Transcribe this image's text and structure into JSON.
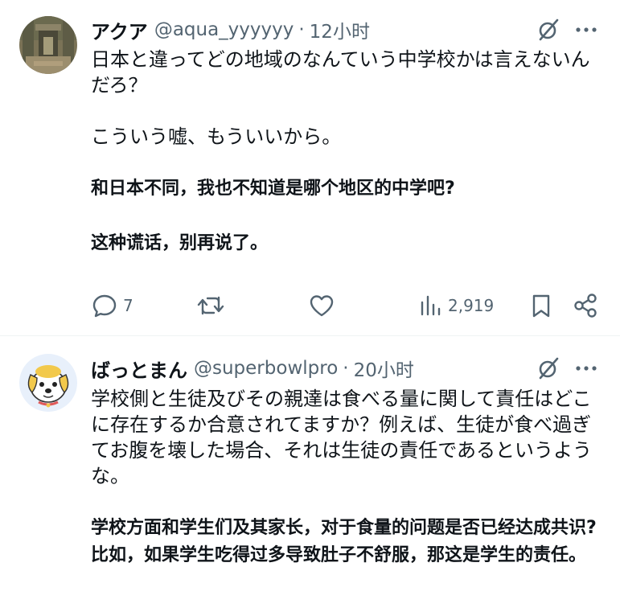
{
  "tweets": [
    {
      "name": "アクア",
      "handle": "@aqua_yyyyyy",
      "separator": "·",
      "time": "12小时",
      "text": "日本と違ってどの地域のなんていう中学校かは言えないんだろ？\n\nこういう嘘、もういいから。",
      "translation": "和日本不同，我也不知道是哪个地区的中学吧?\n\n这种谎话，别再说了。",
      "replies": "7",
      "views": "2,919",
      "icons": [
        "reply-icon",
        "retweet-icon",
        "like-icon",
        "views-icon",
        "bookmark-icon",
        "share-icon",
        "grok-icon",
        "more-icon"
      ]
    },
    {
      "name": "ばっとまん",
      "handle": "@superbowlpro",
      "separator": "·",
      "time": "20小时",
      "text": "学校側と生徒及びその親達は食べる量に関して責任はどこに存在するか合意されてますか？例えば、生徒が食べ過ぎてお腹を壊した場合、それは生徒の責任であるというような。",
      "translation": "学校方面和学生们及其家长，对于食量的问题是否已经达成共识? 比如，如果学生吃得过多导致肚子不舒服，那这是学生的责任。",
      "icons": [
        "grok-icon",
        "more-icon"
      ]
    }
  ],
  "colors": {
    "text": "#0f1419",
    "secondary": "#536471",
    "divider": "#eff3f4"
  }
}
